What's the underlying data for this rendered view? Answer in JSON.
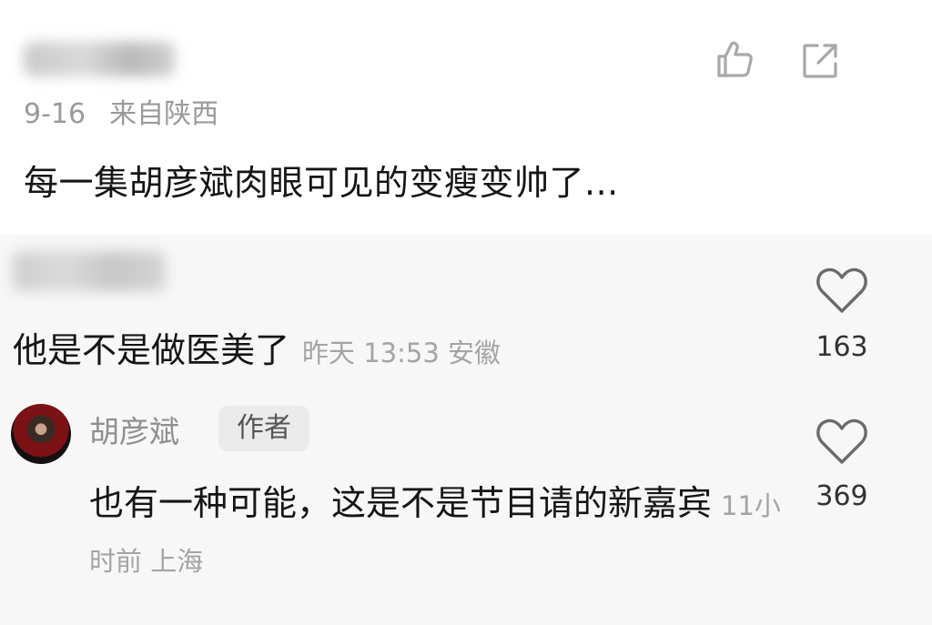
{
  "post": {
    "date": "9-16",
    "location": "来自陕西",
    "text": "每一集胡彦斌肉眼可见的变瘦变帅了...",
    "icons": {
      "like": "thumbs-up-icon",
      "share": "share-icon"
    }
  },
  "comments": [
    {
      "text": "他是不是做医美了",
      "meta": "昨天 13:53 安徽",
      "likes": "163",
      "icon": "heart-icon"
    },
    {
      "author": "胡彦斌",
      "badge": "作者",
      "text": "也有一种可能，这是不是节目请的新嘉宾",
      "meta": "11小时前 上海",
      "likes": "369",
      "icon": "heart-icon"
    }
  ],
  "colors": {
    "background": "#ffffff",
    "comment_background": "#f7f7f7",
    "text": "#151515",
    "muted": "#9a9a9a"
  }
}
